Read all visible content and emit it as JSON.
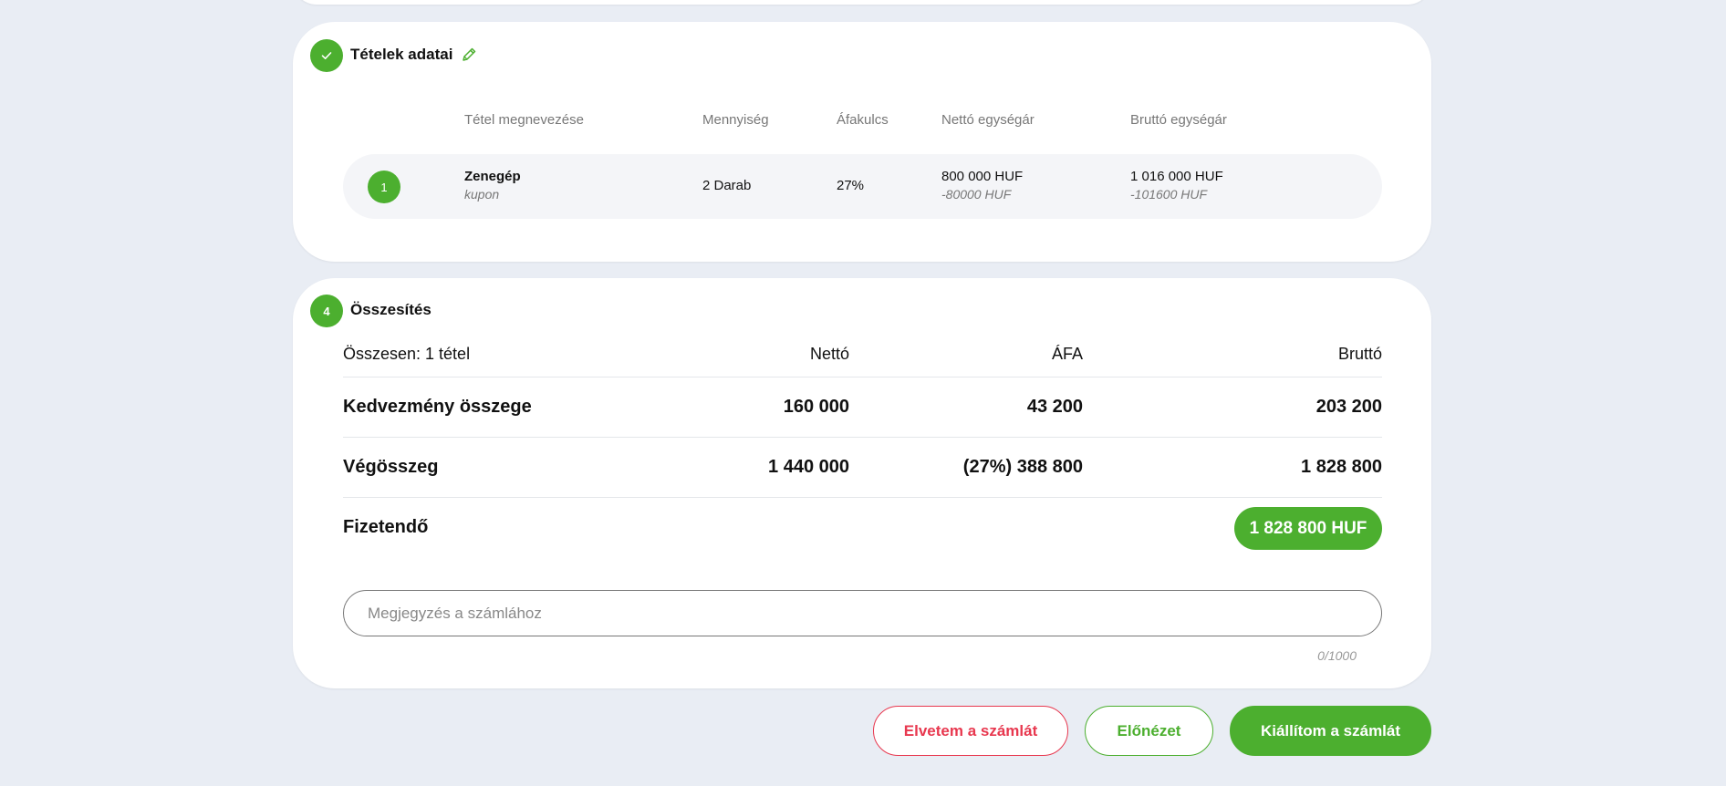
{
  "items_card": {
    "title": "Tételek adatai",
    "columns": {
      "name": "Tétel megnevezése",
      "quantity": "Mennyiség",
      "vat_rate": "Áfakulcs",
      "net_unit_price": "Nettó egységár",
      "gross_unit_price": "Bruttó egységár"
    },
    "rows": [
      {
        "index": "1",
        "name": "Zenegép",
        "subtitle": "kupon",
        "quantity": "2 Darab",
        "vat_rate": "27%",
        "net_unit_price": "800 000 HUF",
        "net_discount": "-80000 HUF",
        "gross_unit_price": "1 016 000 HUF",
        "gross_discount": "-101600 HUF"
      }
    ]
  },
  "summary_card": {
    "step": "4",
    "title": "Összesítés",
    "header": {
      "label": "Összesen: 1 tétel",
      "net": "Nettó",
      "vat": "ÁFA",
      "gross": "Bruttó"
    },
    "discount": {
      "label": "Kedvezmény összege",
      "net": "160 000",
      "vat": "43 200",
      "gross": "203 200"
    },
    "final": {
      "label": "Végösszeg",
      "net": "1 440 000",
      "vat": "(27%) 388 800",
      "gross": "1 828 800"
    },
    "payable": {
      "label": "Fizetendő",
      "amount": "1 828 800 HUF"
    },
    "note": {
      "placeholder": "Megjegyzés a számlához",
      "value": "",
      "counter": "0/1000"
    }
  },
  "actions": {
    "reject": "Elvetem a számlát",
    "preview": "Előnézet",
    "issue": "Kiállítom a számlát"
  },
  "colors": {
    "accent": "#4caf2f",
    "danger": "#e8384f",
    "background": "#e9edf4"
  }
}
